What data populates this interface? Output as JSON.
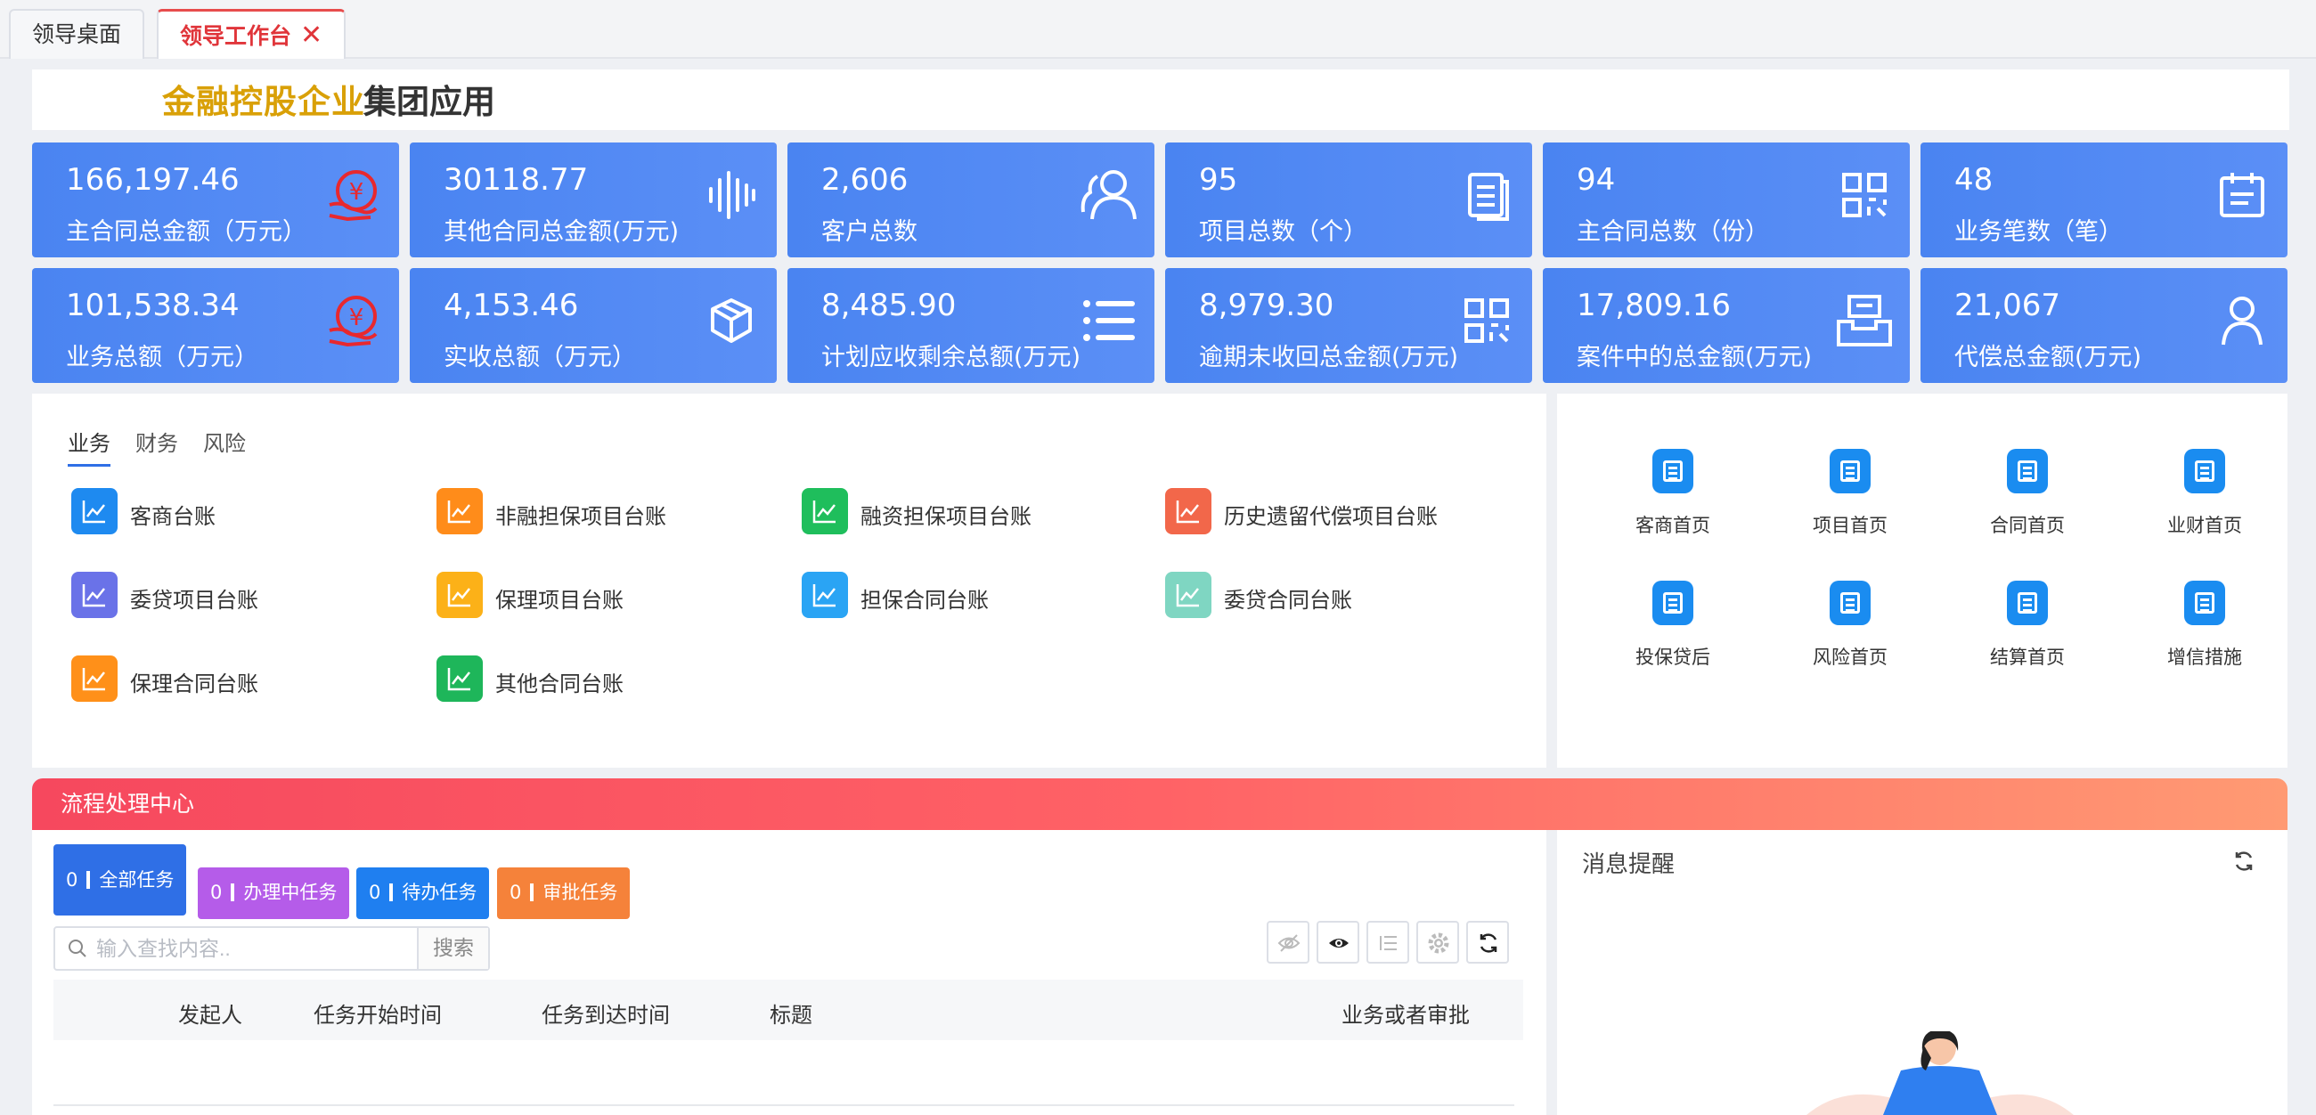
{
  "tabs": [
    {
      "label": "领导桌面"
    },
    {
      "label": "领导工作台",
      "close": "✕"
    }
  ],
  "banner": {
    "brand": "金融控股企业",
    "app": "集团应用"
  },
  "stats": [
    {
      "value": "166,197.46",
      "label": "主合同总金额（万元）",
      "icon": "yuan-hand-icon"
    },
    {
      "value": "30118.77",
      "label": "其他合同总金额(万元)",
      "icon": "sound-wave-icon"
    },
    {
      "value": "2,606",
      "label": "客户总数",
      "icon": "users-icon"
    },
    {
      "value": "95",
      "label": "项目总数（个）",
      "icon": "document-icon"
    },
    {
      "value": "94",
      "label": "主合同总数（份）",
      "icon": "grid-icon"
    },
    {
      "value": "48",
      "label": "业务笔数（笔）",
      "icon": "calendar-icon"
    },
    {
      "value": "101,538.34",
      "label": "业务总额（万元）",
      "icon": "yuan-hand-icon"
    },
    {
      "value": "4,153.46",
      "label": "实收总额（万元）",
      "icon": "cube-icon"
    },
    {
      "value": "8,485.90",
      "label": "计划应收剩余总额(万元)",
      "icon": "list-icon"
    },
    {
      "value": "8,979.30",
      "label": "逾期未收回总金额(万元)",
      "icon": "grid-icon"
    },
    {
      "value": "17,809.16",
      "label": "案件中的总金额(万元)",
      "icon": "inbox-icon"
    },
    {
      "value": "21,067",
      "label": "代偿总金额(万元)",
      "icon": "user-icon"
    }
  ],
  "ledger": {
    "tabs": [
      "业务",
      "财务",
      "风险"
    ],
    "items": [
      {
        "label": "客商台账",
        "color": "#1e8af0"
      },
      {
        "label": "非融担保项目台账",
        "color": "#ff8c1a"
      },
      {
        "label": "融资担保项目台账",
        "color": "#1fbe5c"
      },
      {
        "label": "历史遗留代偿项目台账",
        "color": "#f2674a"
      },
      {
        "label": "委贷项目台账",
        "color": "#6a72e8"
      },
      {
        "label": "保理项目台账",
        "color": "#fcb118"
      },
      {
        "label": "担保合同台账",
        "color": "#2aa4f4"
      },
      {
        "label": "委贷合同台账",
        "color": "#7fd6c2"
      },
      {
        "label": "保理合同台账",
        "color": "#ff9019"
      },
      {
        "label": "其他合同台账",
        "color": "#1eb65a"
      }
    ]
  },
  "quicknav": [
    {
      "label": "客商首页"
    },
    {
      "label": "项目首页"
    },
    {
      "label": "合同首页"
    },
    {
      "label": "业财首页"
    },
    {
      "label": "投保贷后"
    },
    {
      "label": "风险首页"
    },
    {
      "label": "结算首页"
    },
    {
      "label": "增信措施"
    }
  ],
  "process": {
    "title": "流程处理中心",
    "tasks": [
      {
        "count": "0",
        "label": "全部任务",
        "color": "#2f6fe6"
      },
      {
        "count": "0",
        "label": "办理中任务",
        "color": "#b55ce9"
      },
      {
        "count": "0",
        "label": "待办任务",
        "color": "#1f7ff0"
      },
      {
        "count": "0",
        "label": "审批任务",
        "color": "#f5823a"
      }
    ],
    "search": {
      "placeholder": "输入查找内容..",
      "button": "搜索"
    },
    "columns": [
      "发起人",
      "任务开始时间",
      "任务到达时间",
      "标题",
      "业务或者审批"
    ]
  },
  "messages": {
    "title": "消息提醒"
  },
  "colors": {
    "card": "#4a84f1",
    "accent_red": "#e0353a",
    "brand_gold": "#d9a007"
  }
}
